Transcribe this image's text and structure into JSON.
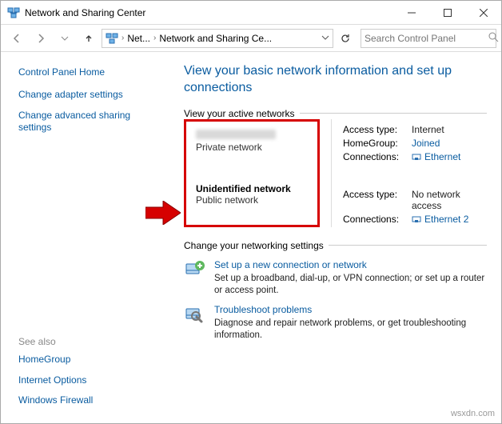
{
  "window": {
    "title": "Network and Sharing Center"
  },
  "breadcrumb": {
    "item1": "Net...",
    "item2": "Network and Sharing Ce..."
  },
  "search": {
    "placeholder": "Search Control Panel"
  },
  "sidebar": {
    "home": "Control Panel Home",
    "links": [
      "Change adapter settings",
      "Change advanced sharing settings"
    ],
    "see_also_label": "See also",
    "see_also": [
      "HomeGroup",
      "Internet Options",
      "Windows Firewall"
    ]
  },
  "content": {
    "heading": "View your basic network information and set up connections",
    "active_label": "View your active networks",
    "net1": {
      "type": "Private network",
      "access_k": "Access type:",
      "access_v": "Internet",
      "hg_k": "HomeGroup:",
      "hg_v": "Joined",
      "conn_k": "Connections:",
      "conn_v": "Ethernet"
    },
    "net2": {
      "name": "Unidentified network",
      "type": "Public network",
      "access_k": "Access type:",
      "access_v": "No network access",
      "conn_k": "Connections:",
      "conn_v": "Ethernet 2"
    },
    "change_label": "Change your networking settings",
    "s1": {
      "title": "Set up a new connection or network",
      "desc": "Set up a broadband, dial-up, or VPN connection; or set up a router or access point."
    },
    "s2": {
      "title": "Troubleshoot problems",
      "desc": "Diagnose and repair network problems, or get troubleshooting information."
    }
  },
  "watermark": "wsxdn.com"
}
